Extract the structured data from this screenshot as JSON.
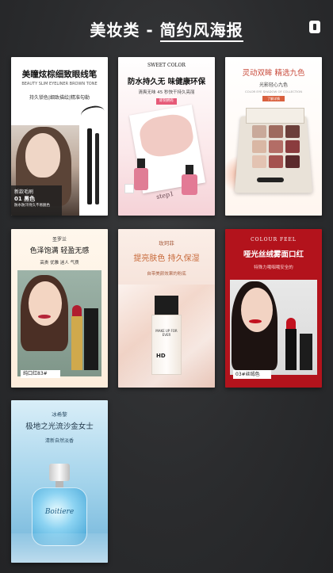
{
  "header": {
    "title_main": "美妆类 - ",
    "title_underlined": "简约风海报"
  },
  "cards": {
    "c1": {
      "title": "美瞳炫棕细致眼线笔",
      "subtitle": "BEAUTY SLIM EYELINER BROWN TONE",
      "features": "持久锁色|细致描绘|精准勾勒",
      "tag_line1": "新款毛刷",
      "tag_line2": "01 黑色",
      "tag_line3": "防水防汗持久不易脱色"
    },
    "c2": {
      "brand": "SWEET COLOR",
      "title": "防水持久无 味健康环保",
      "subtitle": "清爽无味 45 秒快干持久亮丽",
      "button": "即刻拥有",
      "photo_text": "step1"
    },
    "c3": {
      "title": "灵动双眸 精选九色",
      "subtitle": "光影轻心九色",
      "english": "COLOR EYE SHADOW OF COLLECTION",
      "button": "了解详情"
    },
    "c4": {
      "brand": "圣罗兰",
      "title": "色泽饱满 轻盈无感",
      "subtitle": "高贵 优雅 迷人 气质",
      "label": "纯口红83#"
    },
    "c5": {
      "brand": "玫珂菲",
      "title": "提亮肤色 持久保湿",
      "subtitle": "自带美颜效果的粉底",
      "bottle_text": "MAKE UP FOR EVER",
      "bottle_code": "HD"
    },
    "c6": {
      "brand": "COLOUR FEEL",
      "title": "哑光丝绒雾面口红",
      "subtitle": "特殊力哦咽哦安全的",
      "label": "03#丝绒色"
    },
    "c7": {
      "brand": "冰希黎",
      "title": "极地之光流沙金女士",
      "subtitle": "清新自然淡香",
      "bottle_script": "Boitiere"
    }
  },
  "colors": {
    "background": "#2b2c2e",
    "accent_red": "#b3131c",
    "accent_orange": "#c86a3a",
    "accent_pink": "#e65a78"
  }
}
